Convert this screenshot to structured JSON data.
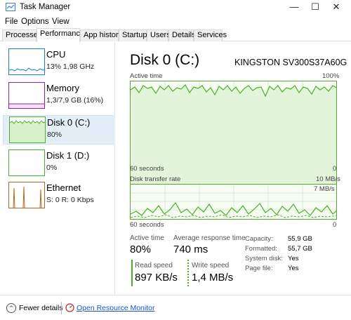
{
  "window": {
    "title": "Task Manager",
    "minimize": "—",
    "maximize": "☐",
    "close": "✕"
  },
  "menu": [
    "File",
    "Options",
    "View"
  ],
  "tabs": [
    "Processes",
    "Performance",
    "App history",
    "Startup",
    "Users",
    "Details",
    "Services"
  ],
  "active_tab": "Performance",
  "sidebar": {
    "items": [
      {
        "name": "CPU",
        "sub": "13% 1,98 GHz",
        "color": "#1a7dd6"
      },
      {
        "name": "Memory",
        "sub": "1,3/7,9 GB (16%)",
        "color": "#8b26a6"
      },
      {
        "name": "Disk 0 (C:)",
        "sub": "80%",
        "color": "#4caf27"
      },
      {
        "name": "Disk 1 (D:)",
        "sub": "0%",
        "color": "#4caf27"
      },
      {
        "name": "Ethernet",
        "sub": "S: 0 R: 0 Kbps",
        "color": "#b5651d"
      }
    ]
  },
  "detail": {
    "title": "Disk 0 (C:)",
    "model": "KINGSTON SV300S37A60G",
    "active_time_graph": {
      "label": "Active time",
      "max": "100%",
      "span": "60 seconds",
      "min": "0"
    },
    "transfer_graph": {
      "label": "Disk transfer rate",
      "max": "10 MB/s",
      "inner": "7 MB/s",
      "span": "60 seconds",
      "min": "0"
    },
    "stats": {
      "active_time_label": "Active time",
      "active_time": "80%",
      "response_label": "Average response time",
      "response": "740 ms",
      "read_label": "Read speed",
      "read": "897 KB/s",
      "write_label": "Write speed",
      "write": "1,4 MB/s"
    },
    "properties": [
      {
        "label": "Capacity:",
        "value": "55,9 GB"
      },
      {
        "label": "Formatted:",
        "value": "55,7 GB"
      },
      {
        "label": "System disk:",
        "value": "Yes"
      },
      {
        "label": "Page file:",
        "value": "Yes"
      }
    ]
  },
  "footer": {
    "fewer": "Fewer details",
    "monitor": "Open Resource Monitor"
  },
  "colors": {
    "disk_green": "#4caf27",
    "graph_fill": "#f7fcf3",
    "selection": "#e3eef9",
    "link": "#1a55c9"
  }
}
